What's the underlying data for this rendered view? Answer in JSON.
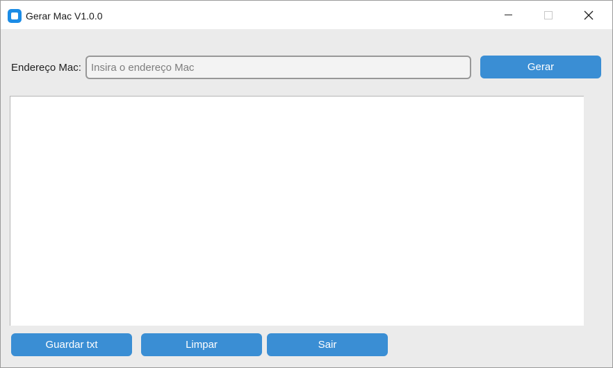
{
  "window": {
    "title": "Gerar Mac V1.0.0",
    "controls": {
      "minimize": "minimize-icon",
      "maximize": "maximize-icon",
      "close": "close-icon"
    }
  },
  "form": {
    "mac_label": "Endereço Mac:",
    "mac_input_value": "",
    "mac_input_placeholder": "Insira o endereço Mac",
    "generate_label": "Gerar"
  },
  "output": {
    "text": ""
  },
  "footer": {
    "save_label": "Guardar txt",
    "clear_label": "Limpar",
    "exit_label": "Sair"
  },
  "colors": {
    "accent": "#3a8ed4",
    "app_icon": "#1b8ce6",
    "background": "#ebebeb"
  }
}
